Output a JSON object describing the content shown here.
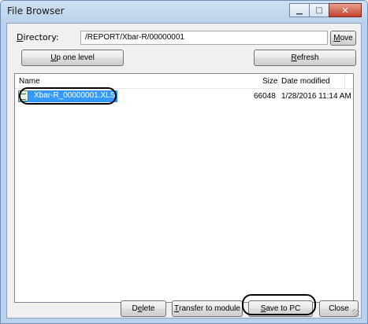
{
  "window": {
    "title": "File Browser",
    "minimize_glyph": "▁",
    "maximize_glyph": "□",
    "close_glyph": "✕"
  },
  "directory": {
    "label_prefix": "D",
    "label_rest": "irectory:",
    "value": "/REPORT/Xbar-R/00000001",
    "move_prefix": "M",
    "move_rest": "ove"
  },
  "nav": {
    "up_prefix": "U",
    "up_rest": "p one level",
    "refresh_prefix": "R",
    "refresh_rest": "efresh"
  },
  "file_list": {
    "columns": {
      "name": "Name",
      "size": "Size",
      "date": "Date modified"
    },
    "rows": [
      {
        "name": "Xbar-R_00000001.XLS",
        "size": "66048",
        "date": "1/28/2016 11:14 AM",
        "selected": true,
        "icon": "excel-file-icon"
      }
    ]
  },
  "actions": {
    "delete_a": "D",
    "delete_u": "e",
    "delete_b": "lete",
    "transfer_u": "T",
    "transfer_b": "ransfer to module",
    "save_u": "S",
    "save_b": "ave to PC",
    "close": "Close"
  },
  "colors": {
    "selection": "#3399ff",
    "highlight_outline": "#000000"
  }
}
